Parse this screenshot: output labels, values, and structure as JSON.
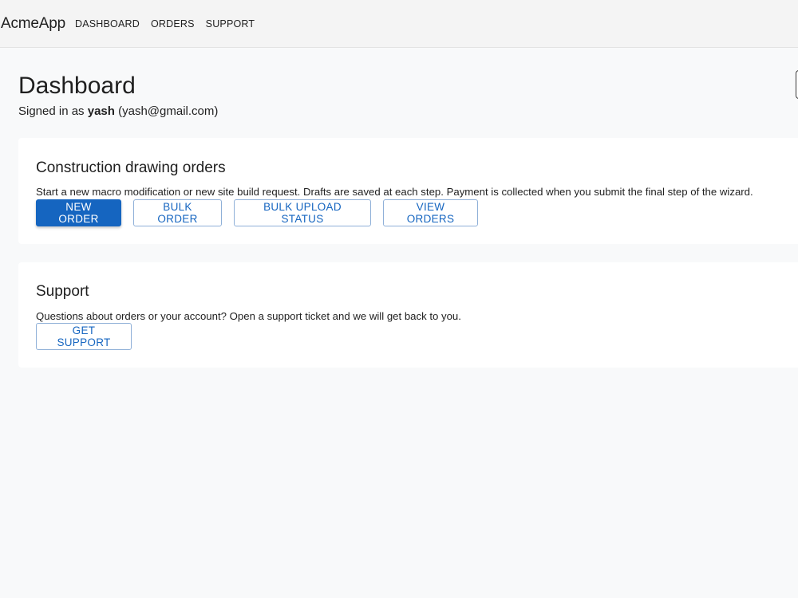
{
  "app": {
    "brand": "AcmeApp",
    "nav": [
      "DASHBOARD",
      "ORDERS",
      "SUPPORT"
    ]
  },
  "header": {
    "title": "Dashboard",
    "signed_in_prefix": "Signed in as ",
    "username": "yash",
    "email": "(yash@gmail.com)"
  },
  "orders_card": {
    "title": "Construction drawing orders",
    "description": "Start a new macro modification or new site build request. Drafts are saved at each step. Payment is collected when you submit the final step of the wizard.",
    "buttons": {
      "new_order": "NEW ORDER",
      "bulk_order": "BULK ORDER",
      "bulk_upload_status": "BULK UPLOAD STATUS",
      "view_orders": "VIEW ORDERS"
    }
  },
  "support_card": {
    "title": "Support",
    "description": "Questions about orders or your account? Open a support ticket and we will get back to you.",
    "buttons": {
      "get_support": "GET SUPPORT"
    }
  },
  "colors": {
    "primary": "#1565c0",
    "background": "#f8f9fa",
    "topbar": "#f4f4f4",
    "card": "#ffffff"
  }
}
